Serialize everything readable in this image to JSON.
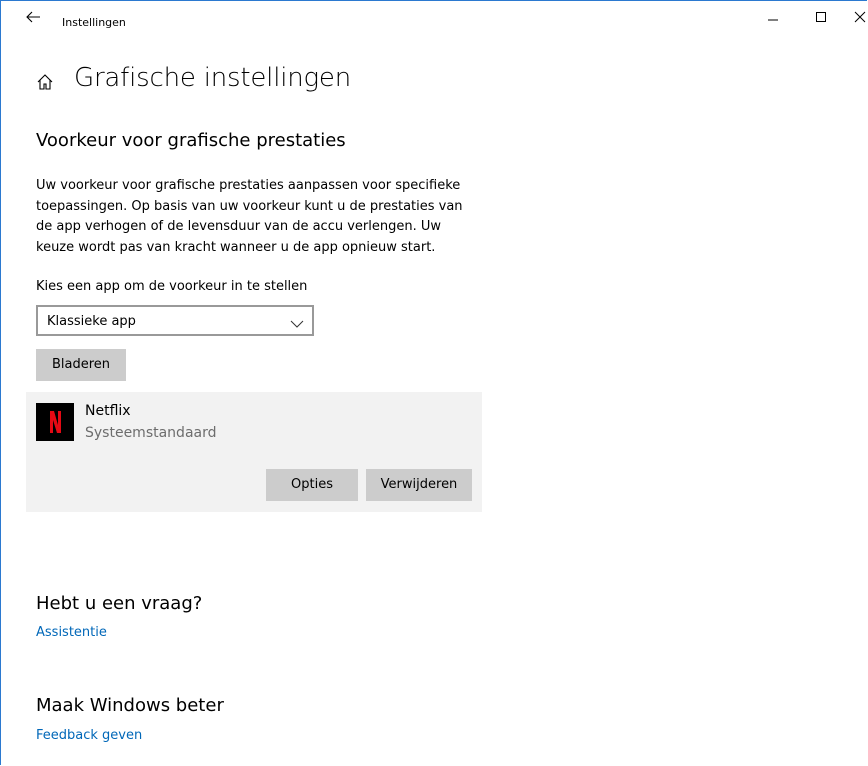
{
  "window": {
    "title": "Instellingen",
    "controls": [
      "minimize",
      "maximize",
      "close"
    ]
  },
  "header": {
    "title": "Grafische instellingen"
  },
  "section": {
    "title": "Voorkeur voor grafische prestaties",
    "description": "Uw voorkeur voor grafische prestaties aanpassen voor specifieke toepassingen. Op basis van uw voorkeur kunt u de prestaties van de app verhogen of de levensduur van de accu verlengen. Uw keuze wordt pas van kracht wanneer u de app opnieuw start.",
    "select_label": "Kies een app om de voorkeur in te stellen",
    "select_value": "Klassieke app",
    "browse_label": "Bladeren"
  },
  "apps": [
    {
      "name": "Netflix",
      "status": "Systeemstandaard",
      "icon": "netflix-logo",
      "options_label": "Opties",
      "remove_label": "Verwijderen"
    }
  ],
  "help": {
    "title": "Hebt u een vraag?",
    "link": "Assistentie"
  },
  "feedback": {
    "title": "Maak Windows beter",
    "link": "Feedback geven"
  },
  "colors": {
    "accent": "#0067b8",
    "button_bg": "#cccccc",
    "card_bg": "#f2f2f2",
    "netflix_red": "#e50914",
    "window_border": "#2b79d0"
  }
}
